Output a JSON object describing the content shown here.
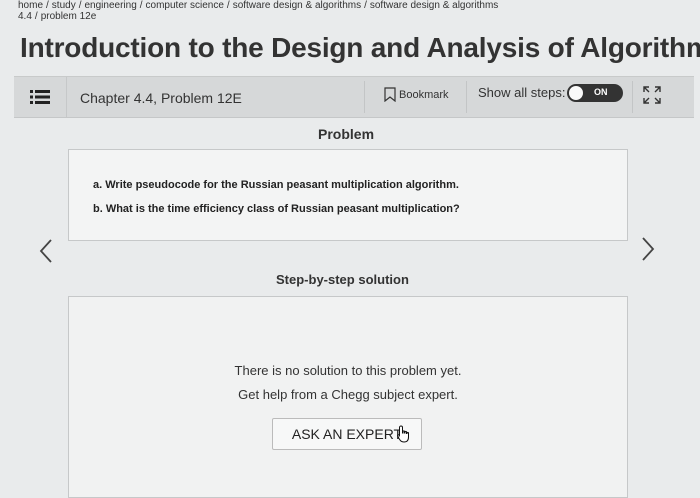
{
  "breadcrumb": {
    "items": [
      "home",
      "study",
      "engineering",
      "computer science",
      "software design & algorithms",
      "software design & algorithms"
    ],
    "sub": [
      "4.4",
      "problem 12e"
    ]
  },
  "page": {
    "title": "Introduction to the Design and Analysis of Algorithms"
  },
  "toolbar": {
    "chapter": "Chapter 4.4, Problem 12E",
    "bookmark_label": "Bookmark",
    "show_steps_label": "Show all steps:",
    "toggle_label": "ON"
  },
  "problem": {
    "heading": "Problem",
    "lines": [
      "a. Write pseudocode for the Russian peasant multiplication algorithm.",
      "b. What is the time efficiency class of Russian peasant multiplication?"
    ]
  },
  "solution": {
    "heading": "Step-by-step solution",
    "message_line1": "There is no solution to this problem yet.",
    "message_line2": "Get help from a Chegg subject expert.",
    "ask_button": "ASK AN EXPERT"
  },
  "icons": {
    "menu": "list-icon",
    "bookmark": "bookmark-icon",
    "expand": "expand-icon",
    "prev": "chevron-left-icon",
    "next": "chevron-right-icon",
    "cursor": "hand-cursor-icon"
  }
}
